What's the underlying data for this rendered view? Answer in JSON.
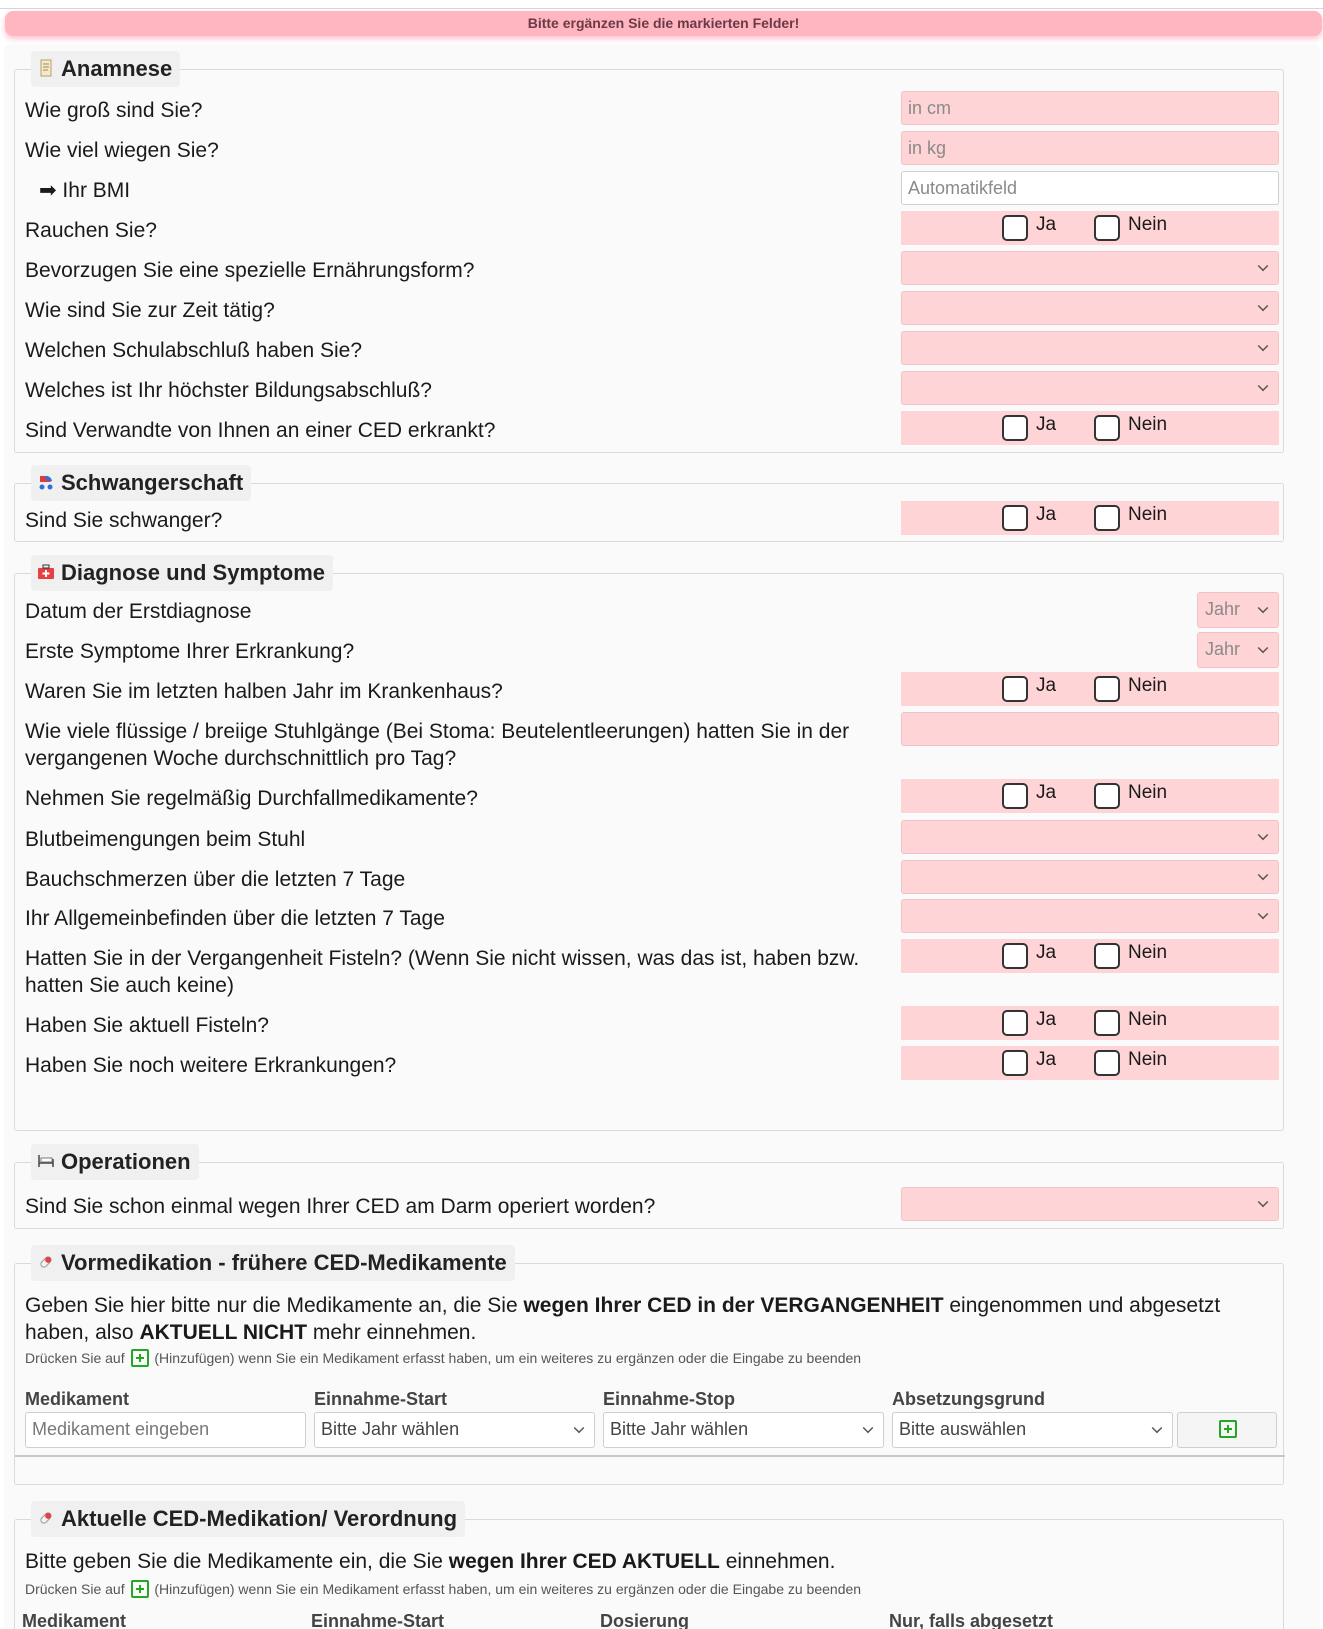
{
  "alert": "Bitte ergänzen Sie die markierten Felder!",
  "yes": "Ja",
  "no": "Nein",
  "sections": {
    "anamnese": {
      "title": "Anamnese",
      "height_q": "Wie groß sind Sie?",
      "height_ph": "in cm",
      "weight_q": "Wie viel wiegen Sie?",
      "weight_ph": "in kg",
      "bmi_q": "➡ Ihr BMI",
      "bmi_ph": "Automatikfeld",
      "smoke_q": "Rauchen Sie?",
      "diet_q": "Bevorzugen Sie eine spezielle Ernährungsform?",
      "job_q": "Wie sind Sie zur Zeit tätig?",
      "school_q": "Welchen Schulabschluß haben Sie?",
      "edu_q": "Welches ist Ihr höchster Bildungsabschluß?",
      "relatives_q": "Sind Verwandte von Ihnen an einer CED erkrankt?"
    },
    "pregnancy": {
      "title": "Schwangerschaft",
      "pregnant_q": "Sind Sie schwanger?"
    },
    "diagnosis": {
      "title": "Diagnose und Symptome",
      "first_diag_q": "Datum der Erstdiagnose",
      "first_symp_q": "Erste Symptome Ihrer Erkrankung?",
      "year_label": "Jahr",
      "hospital_q": "Waren Sie im letzten halben Jahr im Krankenhaus?",
      "stool_q": "Wie viele flüssige / breiige Stuhlgänge (Bei Stoma: Beutelentleerungen) hatten Sie in der vergangenen Woche durchschnittlich pro Tag?",
      "diarrhea_med_q": "Nehmen Sie regelmäßig Durchfallmedikamente?",
      "blood_q": "Blutbeimengungen beim Stuhl",
      "pain_q": "Bauchschmerzen über die letzten 7 Tage",
      "wellbeing_q": "Ihr Allgemeinbefinden über die letzten 7 Tage",
      "fistula_past_q": "Hatten Sie in der Vergangenheit Fisteln? (Wenn Sie nicht wissen, was das ist, haben bzw. hatten Sie auch keine)",
      "fistula_now_q": "Haben Sie aktuell Fisteln?",
      "other_q": "Haben Sie noch weitere Erkrankungen?"
    },
    "operations": {
      "title": "Operationen",
      "surgery_q": "Sind Sie schon einmal wegen Ihrer CED am Darm operiert worden?"
    },
    "premed": {
      "title": "Vormedikation - frühere CED-Medikamente",
      "intro_1": "Geben Sie hier bitte nur die Medikamente an, die Sie ",
      "intro_b1": "wegen Ihrer CED in der VERGANGENHEIT",
      "intro_2": " eingenommen und abgesetzt haben, also ",
      "intro_b2": "AKTUELL NICHT",
      "intro_3": " mehr einnehmen.",
      "hint_1": "Drücken Sie auf",
      "hint_2": "(Hinzufügen) wenn Sie ein Medikament erfasst haben, um ein weiteres zu ergänzen oder die Eingabe zu beenden",
      "col_med": "Medikament",
      "col_start": "Einnahme-Start",
      "col_stop": "Einnahme-Stop",
      "col_reason": "Absetzungsgrund",
      "med_ph": "Medikament eingeben",
      "start_val": "Bitte Jahr wählen",
      "stop_val": "Bitte Jahr wählen",
      "reason_val": "Bitte auswählen"
    },
    "curmed": {
      "title": "Aktuelle CED-Medikation/ Verordnung",
      "intro_1": "Bitte geben Sie die Medikamente ein, die Sie ",
      "intro_b1": "wegen Ihrer CED AKTUELL",
      "intro_2": " einnehmen.",
      "hint_1": "Drücken Sie auf",
      "hint_2": "(Hinzufügen) wenn Sie ein Medikament erfasst haben, um ein weiteres zu ergänzen oder die Eingabe zu beenden",
      "col_med": "Medikament",
      "col_start": "Einnahme-Start",
      "col_dose": "Dosierung",
      "col_stopped": "Nur, falls abgesetzt"
    }
  },
  "colors": {
    "required": "#ffd4d6",
    "alert": "#ffb6c1",
    "add": "#22a822"
  }
}
